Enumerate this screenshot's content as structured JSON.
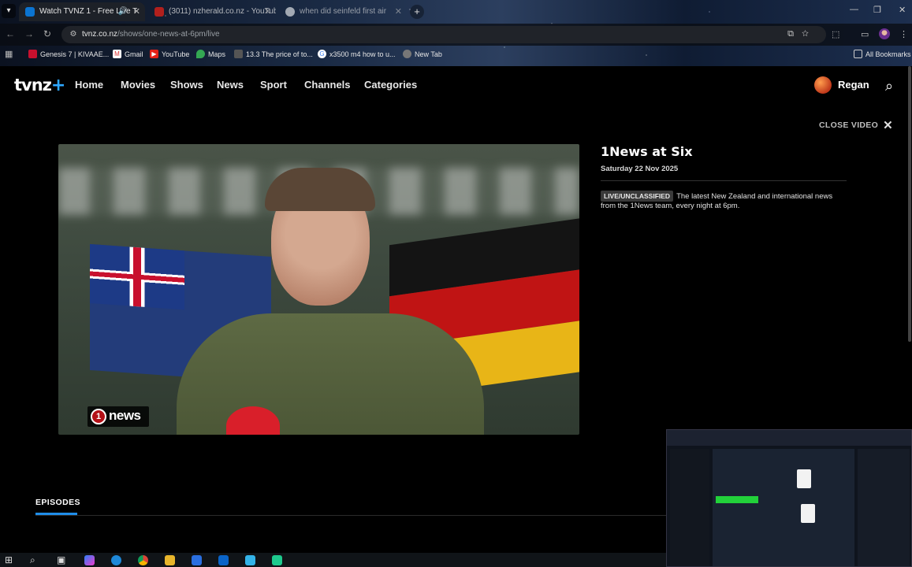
{
  "browser": {
    "tabs": [
      {
        "title": "Watch TVNZ 1 - Free Live T",
        "active": true
      },
      {
        "title": "(3011) nzherald.co.nz - YouTub",
        "active": false
      },
      {
        "title": "when did seinfeld first air",
        "active": false
      }
    ],
    "url_domain": "tvnz.co.nz",
    "url_path": "/shows/one-news-at-6pm/live",
    "bookmarks": [
      {
        "label": "Genesis 7 | KIVAAE...",
        "icon": "bookmark-icon"
      },
      {
        "label": "Gmail",
        "icon": "gmail-icon"
      },
      {
        "label": "YouTube",
        "icon": "youtube-icon"
      },
      {
        "label": "Maps",
        "icon": "maps-icon"
      },
      {
        "label": "13.3 The price of to...",
        "icon": "page-icon"
      },
      {
        "label": "x3500 m4 how to u...",
        "icon": "google-icon"
      },
      {
        "label": "New Tab",
        "icon": "globe-icon"
      }
    ],
    "all_bookmarks": "All Bookmarks"
  },
  "site": {
    "logo": "tvnz",
    "logo_plus": "+",
    "nav": [
      "Home",
      "Movies",
      "Shows",
      "News",
      "Sport",
      "Channels",
      "Categories"
    ],
    "user": "Regan"
  },
  "player": {
    "close_label": "CLOSE VIDEO",
    "bug_num": "1",
    "bug_text": "news"
  },
  "program": {
    "title": "1News at Six",
    "date": "Saturday 22 Nov 2025",
    "badge": "LIVE/UNCLASSIFIED",
    "description": "The latest New Zealand and international news from the 1News team, every night at 6pm."
  },
  "episodes": {
    "tab": "EPISODES"
  },
  "colors": {
    "accent": "#1f8de8",
    "brand_plus": "#2ea8ff",
    "news_red": "#b31017"
  }
}
